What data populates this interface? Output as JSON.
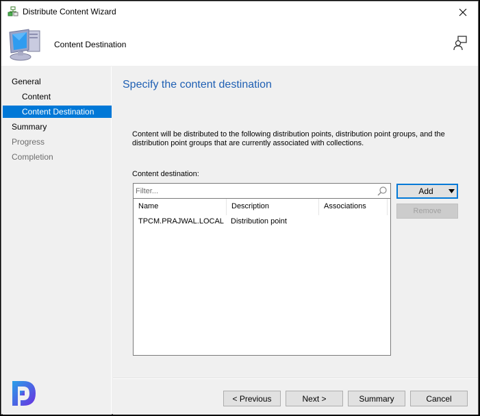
{
  "window": {
    "title": "Distribute Content Wizard",
    "close_icon": "close-icon",
    "app_icon": "distribute-content-icon"
  },
  "header": {
    "title": "Content Destination",
    "icon": "computer-icon",
    "help_icon": "user-help-icon"
  },
  "sidebar": {
    "items": [
      {
        "label": "General",
        "state": "normal",
        "level": 0
      },
      {
        "label": "Content",
        "state": "normal",
        "level": 1
      },
      {
        "label": "Content Destination",
        "state": "active",
        "level": 1
      },
      {
        "label": "Summary",
        "state": "normal",
        "level": 0
      },
      {
        "label": "Progress",
        "state": "disabled",
        "level": 0
      },
      {
        "label": "Completion",
        "state": "disabled",
        "level": 0
      }
    ]
  },
  "main": {
    "title": "Specify the content destination",
    "description": "Content will be distributed to the following distribution points, distribution point groups, and the distribution point groups that are currently associated with collections.",
    "content_destination_label": "Content destination:",
    "filter": {
      "value": "",
      "placeholder": "Filter..."
    },
    "table": {
      "columns": [
        "Name",
        "Description",
        "Associations"
      ],
      "rows": [
        {
          "name": "TPCM.PRAJWAL.LOCAL",
          "description": "Distribution point",
          "associations": ""
        }
      ]
    },
    "buttons": {
      "add": "Add",
      "remove": "Remove"
    }
  },
  "footer": {
    "previous": "< Previous",
    "next": "Next >",
    "summary": "Summary",
    "cancel": "Cancel"
  },
  "colors": {
    "accent": "#0078d7",
    "title_blue": "#1e5fb3",
    "logo_purple": "#5b3fd8"
  }
}
